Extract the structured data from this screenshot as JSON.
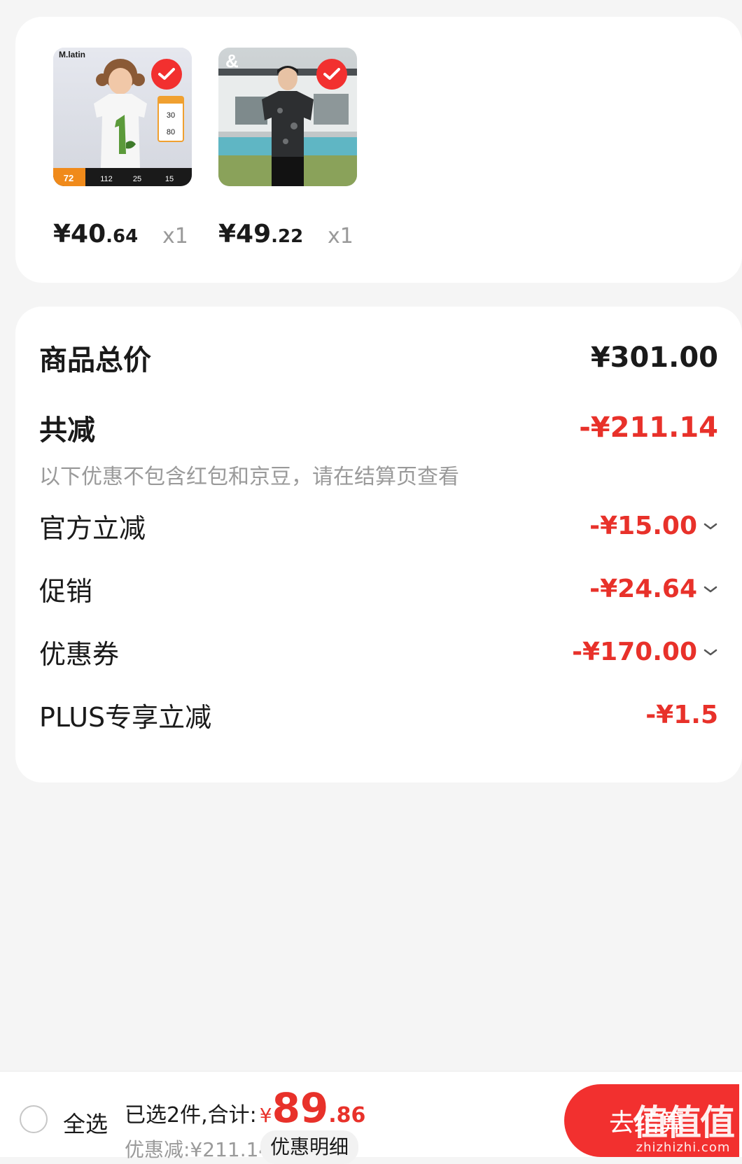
{
  "products": [
    {
      "brand": "M.latin",
      "price_int": "¥40",
      "price_dec": ".64",
      "qty": "x1",
      "selected": true,
      "image": "child-tshirt-photo",
      "promo": {
        "tag_num": "72",
        "stats": [
          "112",
          "25",
          "15"
        ],
        "side_a": "30",
        "side_b": "80"
      }
    },
    {
      "brand": "&",
      "price_int": "¥49",
      "price_dec": ".22",
      "qty": "x1",
      "selected": true,
      "image": "man-tshirt-photo"
    }
  ],
  "summary": {
    "total_label": "商品总价",
    "total_value": "¥301.00",
    "reduce_label": "共减",
    "reduce_value": "-¥211.14",
    "note": "以下优惠不包含红包和京豆，请在结算页查看",
    "items": [
      {
        "label": "官方立减",
        "value": "-¥15.00",
        "expandable": true
      },
      {
        "label": "促销",
        "value": "-¥24.64",
        "expandable": true
      },
      {
        "label": "优惠券",
        "value": "-¥170.00",
        "expandable": true
      },
      {
        "label": "PLUS专享立减",
        "value": "-¥1.5",
        "expandable": false
      }
    ]
  },
  "bottom": {
    "select_all": "全选",
    "selected_text": "已选2件,合计:",
    "currency": "¥",
    "total_int": "89",
    "total_dec": ".86",
    "saved": "优惠减:¥211.14",
    "detail": "优惠明细",
    "checkout": "去结算",
    "watermark_big": "值值值",
    "watermark_small": "zhizhizhi.com"
  },
  "colors": {
    "accent": "#f2302f",
    "discount": "#e8312a",
    "muted": "#9a9a9a",
    "background": "#f5f5f5"
  }
}
